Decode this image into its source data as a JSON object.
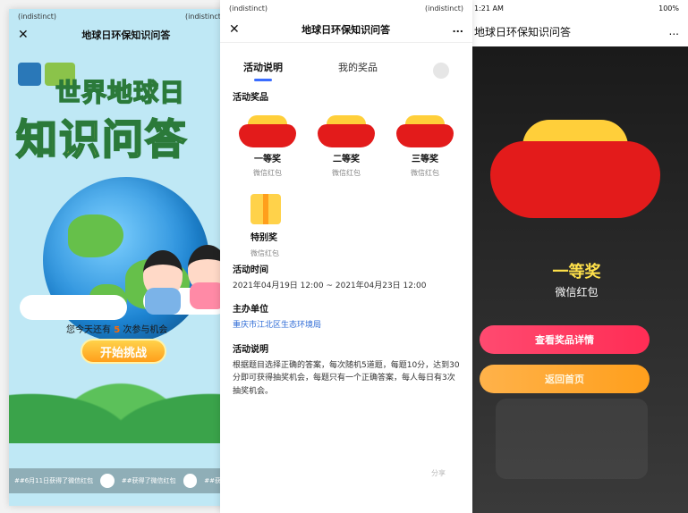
{
  "screens": {
    "left": {
      "status": {
        "left": "(indistinct)",
        "right": "(indistinct)"
      },
      "nav": {
        "title": "地球日环保知识问答"
      },
      "hero": {
        "title_line_1": "世界地球日",
        "title_line_2": "知识问答"
      },
      "chances": {
        "prefix": "您今天还有",
        "count": "5",
        "suffix": "次参与机会"
      },
      "start_button": "开始挑战",
      "ticker": [
        "##6月11日获得了微信红包",
        "##获得了微信红包",
        "##获得"
      ]
    },
    "middle": {
      "status": {
        "left": "(indistinct)",
        "right": "(indistinct)"
      },
      "nav": {
        "title": "地球日环保知识问答",
        "more": "..."
      },
      "tabs": [
        "活动说明",
        "我的奖品"
      ],
      "sections": {
        "prizes_title": "活动奖品",
        "prizes": [
          {
            "name": "一等奖",
            "sub": "微信红包"
          },
          {
            "name": "二等奖",
            "sub": "微信红包"
          },
          {
            "name": "三等奖",
            "sub": "微信红包"
          }
        ],
        "special_prize": {
          "name": "特别奖",
          "sub": "微信红包"
        },
        "time_title": "活动时间",
        "time_value": "2021年04月19日 12:00 ~ 2021年04月23日 12:00",
        "organizer_title": "主办单位",
        "organizer_value": "重庆市江北区生态环境局",
        "desc_title": "活动说明",
        "desc_value": "根据题目选择正确的答案，每次随机5道题，每题10分，达到30分即可获得抽奖机会，每题只有一个正确答案，每人每日有3次抽奖机会。"
      },
      "footer_action": "分享"
    },
    "right": {
      "status": {
        "left": "1:21 AM",
        "right": "100%"
      },
      "nav": {
        "title": "地球日环保知识问答",
        "more": "..."
      },
      "prize": "一等奖",
      "prize_sub": "微信红包",
      "buttons": {
        "primary": "查看奖品详情",
        "secondary": "返回首页"
      }
    }
  },
  "colors": {
    "accent_blue": "#3a6cff",
    "red": "#e31b1b",
    "gold": "#ffcf3a",
    "pink": "#ff2d55",
    "orange": "#ff9f1c",
    "link": "#2e6bd6"
  }
}
